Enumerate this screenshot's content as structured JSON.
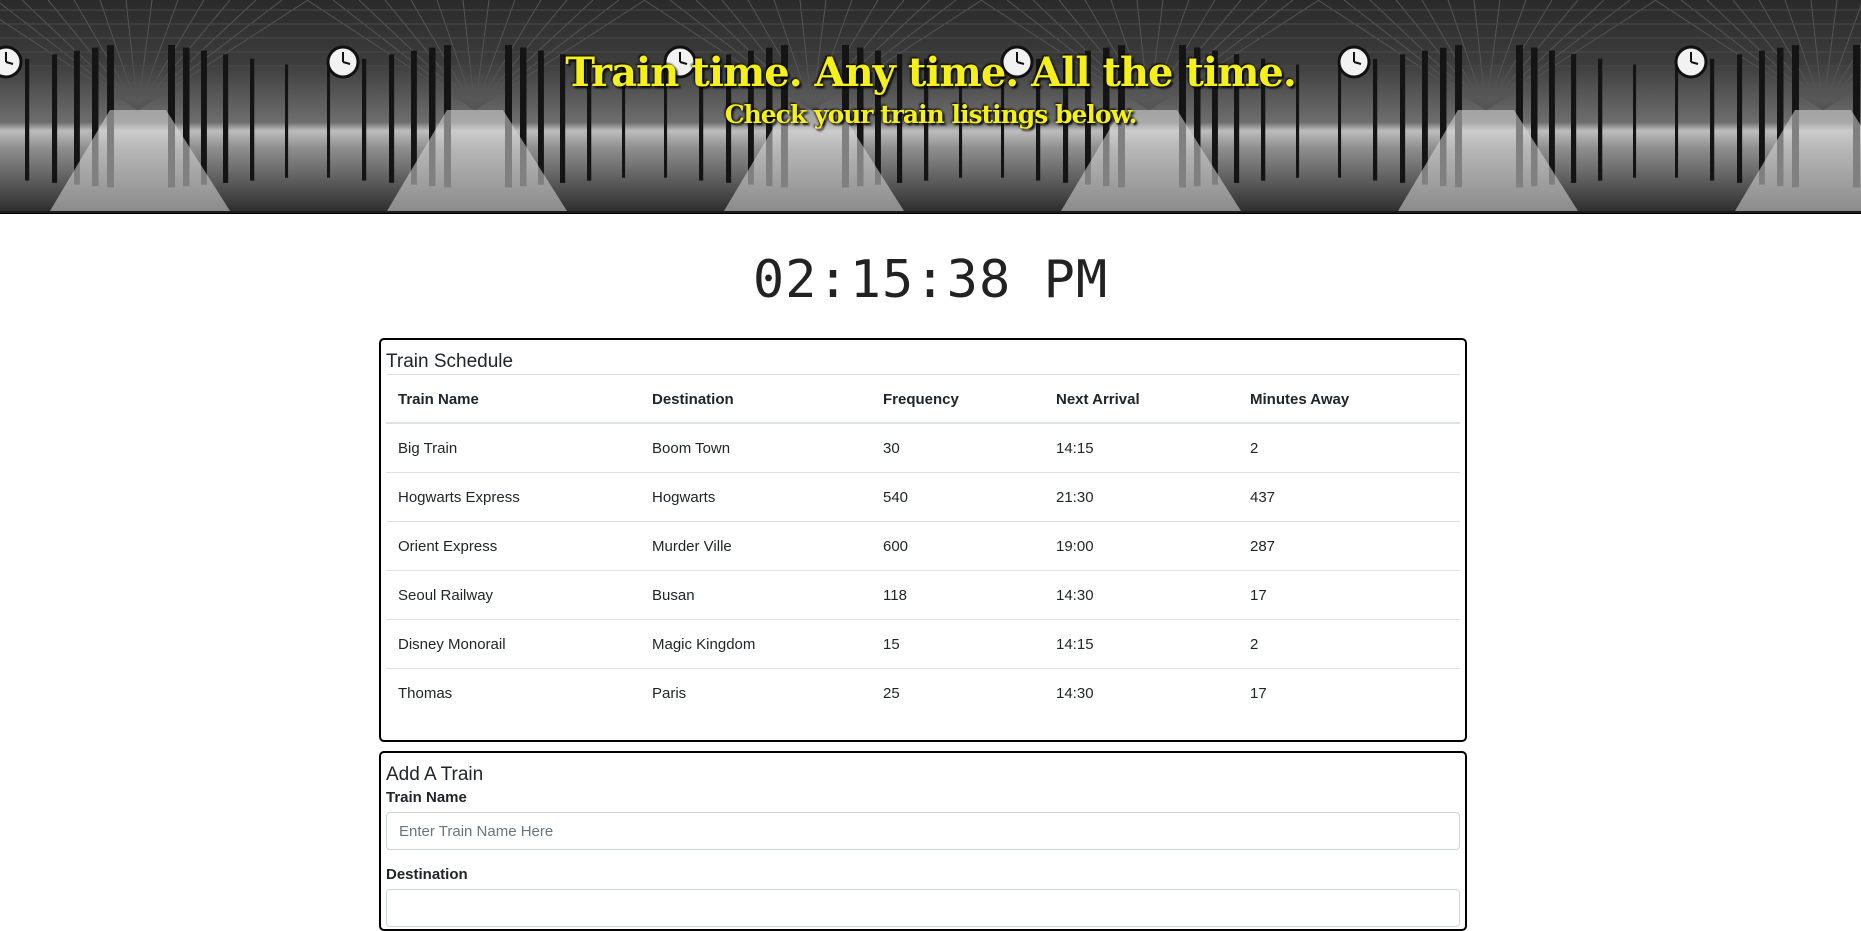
{
  "header": {
    "title": "Train time. Any time. All the time.",
    "subtitle": "Check your train listings below."
  },
  "clock": {
    "time": "02:15:38 PM"
  },
  "schedule": {
    "heading": "Train Schedule",
    "columns": [
      "Train Name",
      "Destination",
      "Frequency",
      "Next Arrival",
      "Minutes Away"
    ],
    "rows": [
      [
        "Big Train",
        "Boom Town",
        "30",
        "14:15",
        "2"
      ],
      [
        "Hogwarts Express",
        "Hogwarts",
        "540",
        "21:30",
        "437"
      ],
      [
        "Orient Express",
        "Murder Ville",
        "600",
        "19:00",
        "287"
      ],
      [
        "Seoul Railway",
        "Busan",
        "118",
        "14:30",
        "17"
      ],
      [
        "Disney Monorail",
        "Magic Kingdom",
        "15",
        "14:15",
        "2"
      ],
      [
        "Thomas",
        "Paris",
        "25",
        "14:30",
        "17"
      ]
    ]
  },
  "add_train": {
    "heading": "Add A Train",
    "train_name_label": "Train Name",
    "train_name_placeholder": "Enter Train Name Here",
    "destination_label": "Destination",
    "destination_placeholder": ""
  },
  "colors": {
    "title": "#f5f01a",
    "border": "#000000"
  }
}
